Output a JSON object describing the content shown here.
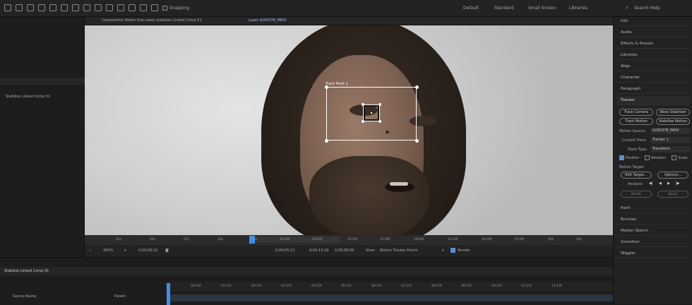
{
  "toolbar": {
    "snapping_label": "Snapping",
    "workspaces": [
      "Default",
      "Standard",
      "Small Screen",
      "Libraries"
    ],
    "search_placeholder": "Search Help"
  },
  "left_panel": {
    "item_label": "Stabilize Linked Comp 01"
  },
  "viewer_tabs": {
    "composition_tab": "Composition Better than warp stabilizer Linked Comp 01",
    "layer_tab": "Layer A160378_lMOV"
  },
  "viewer": {
    "track_point_label": "Track Point 1"
  },
  "ruler_ticks": [
    "01s",
    "04s",
    "07s",
    "10s",
    "13s",
    "16:00f",
    "19:00f",
    "22:00f",
    "25:00f",
    "28:00f",
    "31:00f",
    "34:00f",
    "37:00f",
    "40s",
    "43s",
    "46s",
    "49s",
    "52s"
  ],
  "viewer_bar": {
    "zoom": "400%",
    "timecode": "0;04;05;12",
    "in_point": "0;04;05;12",
    "out_point": "0;04;13;18",
    "duration": "0;00;08;09",
    "view_label": "View:",
    "view_value": "Motion Tracker Points",
    "render_label": "Render",
    "render_checked": true
  },
  "right_panel": {
    "items_top": [
      "Info",
      "Audio",
      "Effects & Presets",
      "Libraries",
      "Align",
      "Character",
      "Paragraph"
    ],
    "tracker_title": "Tracker",
    "buttons": [
      "Track Camera",
      "Warp Stabilizer",
      "Track Motion",
      "Stabilize Motion"
    ],
    "motion_source_label": "Motion Source:",
    "motion_source_value": "A160378_lMOV",
    "current_track_label": "Current Track:",
    "current_track_value": "Tracker 1",
    "track_type_label": "Track Type:",
    "track_type_value": "Transform",
    "position_label": "Position",
    "position_checked": true,
    "rotation_label": "Rotation",
    "rotation_checked": false,
    "scale_label": "Scale",
    "scale_checked": false,
    "motion_target_label": "Motion Target:",
    "edit_target_label": "Edit Target...",
    "options_label": "Options...",
    "analyze_label": "Analyze:",
    "reset_label": "Reset",
    "apply_label": "Apply",
    "items_bottom": [
      "Paint",
      "Brushes",
      "Motion Sketch",
      "Smoother",
      "Wiggler"
    ]
  },
  "timeline": {
    "tab_label": "Stabilize Linked Comp 01",
    "source_name_header": "Source Name",
    "parent_header": "Parent",
    "ticks": [
      "00:15f",
      "01:15f",
      "02:15f",
      "03:15f",
      "04:15f",
      "05:15f",
      "06:15f",
      "07:15f",
      "08:15f",
      "09:15f",
      "10:15f",
      "11:15f",
      "12:15f"
    ]
  }
}
